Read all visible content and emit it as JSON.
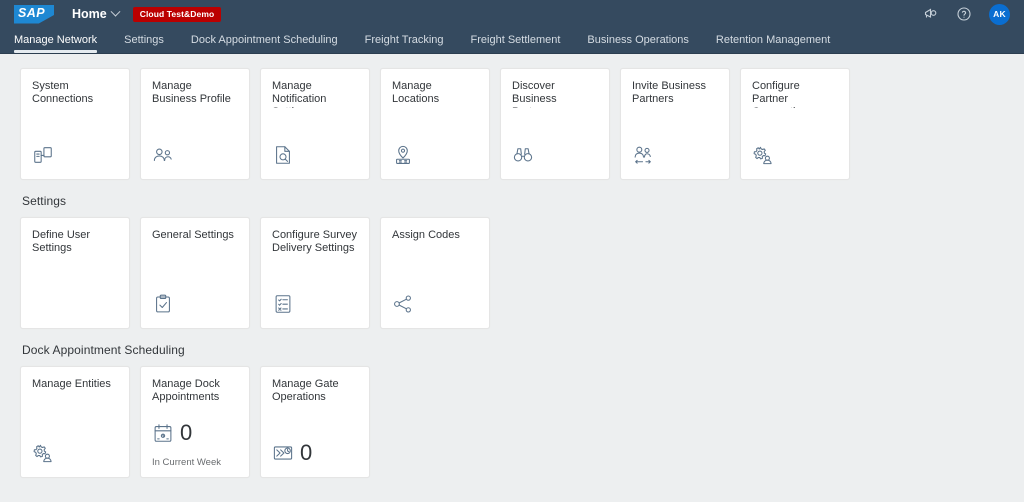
{
  "shellbar": {
    "logo_text": "SAP",
    "logo_name": "sap-logo",
    "home_label": "Home",
    "badge_label": "Cloud Test&Demo",
    "feedback_icon": "megaphone-icon",
    "help_icon": "question-mark-icon",
    "avatar_initials": "AK",
    "colors": {
      "header_bg": "#354a5f",
      "badge_bg": "#bb0000",
      "avatar_bg": "#0a6ed1",
      "logo_bg": "#1e88d3"
    }
  },
  "navigation": {
    "tabs": [
      {
        "label": "Manage Network",
        "active": true
      },
      {
        "label": "Settings",
        "active": false
      },
      {
        "label": "Dock Appointment Scheduling",
        "active": false
      },
      {
        "label": "Freight Tracking",
        "active": false
      },
      {
        "label": "Freight Settlement",
        "active": false
      },
      {
        "label": "Business Operations",
        "active": false
      },
      {
        "label": "Retention Management",
        "active": false
      }
    ]
  },
  "sections": [
    {
      "title": "",
      "tiles": [
        {
          "title": "System Connections",
          "icon": "connected-devices-icon"
        },
        {
          "title": "Manage Business Profile",
          "icon": "business-group-icon"
        },
        {
          "title": "Manage Notification Settings",
          "icon": "document-search-icon"
        },
        {
          "title": "Manage Locations",
          "icon": "location-pin-icon"
        },
        {
          "title": "Discover Business Partners",
          "icon": "binoculars-icon"
        },
        {
          "title": "Invite Business Partners",
          "icon": "people-exchange-icon"
        },
        {
          "title": "Configure Partner Connections",
          "icon": "gear-person-icon"
        }
      ]
    },
    {
      "title": "Settings",
      "tiles": [
        {
          "title": "Define User Settings",
          "icon": ""
        },
        {
          "title": "General Settings",
          "icon": "clipboard-check-icon"
        },
        {
          "title": "Configure Survey Delivery Settings",
          "icon": "survey-list-icon"
        },
        {
          "title": "Assign Codes",
          "icon": "share-nodes-icon"
        }
      ]
    },
    {
      "title": "Dock Appointment Scheduling",
      "tiles": [
        {
          "title": "Manage Entities",
          "icon": "gear-person-icon"
        },
        {
          "title": "Manage Dock Appointments",
          "icon": "calendar-icon",
          "value": "0",
          "subtitle": "In Current Week"
        },
        {
          "title": "Manage Gate Operations",
          "icon": "gate-clock-icon",
          "value": "0",
          "subtitle": ""
        }
      ]
    }
  ]
}
